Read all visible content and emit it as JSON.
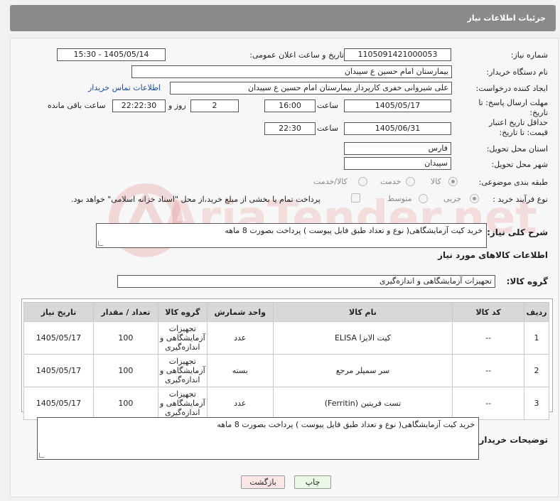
{
  "header": {
    "title": "جزئیات اطلاعات نیاز"
  },
  "form": {
    "need_number_label": "شماره نیاز:",
    "need_number": "1105091421000053",
    "announce_label": "تاریخ و ساعت اعلان عمومی:",
    "announce_value": "1405/05/14 - 15:30",
    "buyer_org_label": "نام دستگاه خریدار:",
    "buyer_org": "بیمارستان امام حسین  ع  سپیدان",
    "creator_label": "ایجاد کننده درخواست:",
    "creator": "علی شیروانی خفری کارپرداز بیمارستان امام حسین  ع  سپیدان",
    "contact_link": "اطلاعات تماس خریدار",
    "deadline_label": "مهلت ارسال پاسخ: تا تاریخ:",
    "deadline_date": "1405/05/17",
    "time_label": "ساعت",
    "deadline_time": "16:00",
    "days_value": "2",
    "days_label": "روز و",
    "remaining_time": "22:22:30",
    "remaining_label": "ساعت باقی مانده",
    "validity_label": "حداقل تاریخ اعتبار قیمت: تا تاریخ:",
    "validity_date": "1405/06/31",
    "validity_time": "22:30",
    "province_label": "استان محل تحویل:",
    "province": "فارس",
    "city_label": "شهر محل تحویل:",
    "city": "سپیدان",
    "category_label": "طبقه بندی موضوعی:",
    "category_options": [
      "کالا",
      "خدمت",
      "کالا/خدمت"
    ],
    "process_label": "نوع فرآیند خرید :",
    "process_options": [
      "جزیی",
      "متوسط"
    ],
    "payment_note": "پرداخت تمام یا بخشی از مبلغ خرید،از محل \"اسناد خزانه اسلامی\" خواهد بود."
  },
  "summary": {
    "label": "شرح کلی نیاز:",
    "text": "خرید کیت آزمایشگاهی( نوع و تعداد طبق فایل پیوست ) پرداخت بصورت 8 ماهه"
  },
  "goods": {
    "section_title": "اطلاعات کالاهای مورد نیاز",
    "group_label": "گروه کالا:",
    "group_value": "تجهیزات آزمایشگاهی و اندازه‌گیری",
    "columns": [
      "ردیف",
      "کد کالا",
      "نام کالا",
      "واحد شمارش",
      "گروه کالا",
      "تعداد / مقدار",
      "تاریخ نیاز"
    ],
    "rows": [
      {
        "row": "1",
        "code": "--",
        "name": "کیت الایزا ELISA",
        "unit": "عدد",
        "group": "تجهیزات آزمایشگاهی و اندازه‌گیری",
        "qty": "100",
        "date": "1405/05/17"
      },
      {
        "row": "2",
        "code": "--",
        "name": "سر سمپلر مرجع",
        "unit": "بسته",
        "group": "تجهیزات آزمایشگاهی و اندازه‌گیری",
        "qty": "100",
        "date": "1405/05/17"
      },
      {
        "row": "3",
        "code": "--",
        "name": "تست فریتین (Ferritin)",
        "unit": "عدد",
        "group": "تجهیزات آزمایشگاهی و اندازه‌گیری",
        "qty": "100",
        "date": "1405/05/17"
      }
    ]
  },
  "buyer_notes": {
    "label": "توضیحات خریدار:",
    "text": "خرید کیت آزمایشگاهی( نوع و تعداد طبق فایل پیوست ) پرداخت بصورت 8 ماهه"
  },
  "buttons": {
    "print": "چاپ",
    "back": "بازگشت"
  },
  "watermark": "AriaTender.net",
  "colors": {
    "header_bg": "#8a8a8a",
    "link": "#1a4fa0",
    "print_bg": "#eaf7e4",
    "back_bg": "#fbe6e6"
  }
}
